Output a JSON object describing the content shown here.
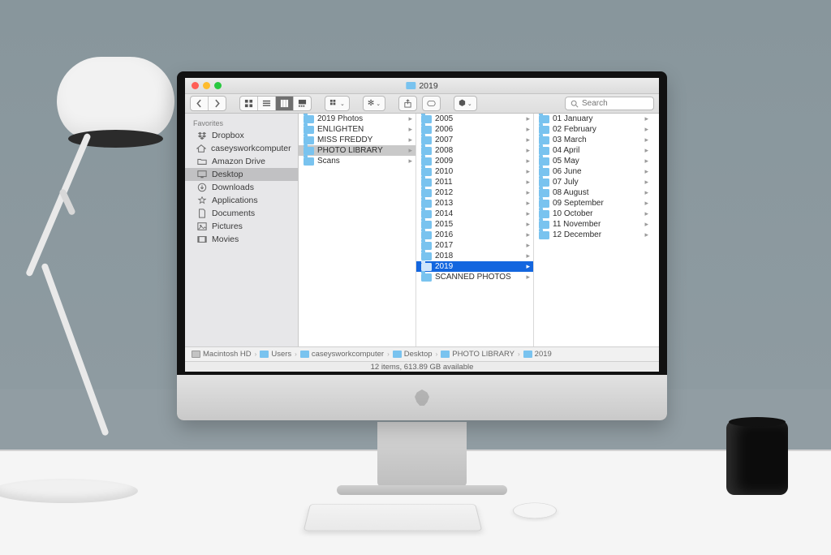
{
  "window": {
    "title": "2019"
  },
  "toolbar": {
    "search_placeholder": "Search"
  },
  "sidebar": {
    "header": "Favorites",
    "items": [
      {
        "label": "Dropbox",
        "icon": "dropbox"
      },
      {
        "label": "caseysworkcomputer",
        "icon": "home"
      },
      {
        "label": "Amazon Drive",
        "icon": "folder"
      },
      {
        "label": "Desktop",
        "icon": "desktop",
        "selected": true
      },
      {
        "label": "Downloads",
        "icon": "downloads"
      },
      {
        "label": "Applications",
        "icon": "applications"
      },
      {
        "label": "Documents",
        "icon": "documents"
      },
      {
        "label": "Pictures",
        "icon": "pictures"
      },
      {
        "label": "Movies",
        "icon": "movies"
      }
    ]
  },
  "columns": [
    {
      "items": [
        {
          "label": "2019 Photos"
        },
        {
          "label": "ENLIGHTEN"
        },
        {
          "label": "MISS FREDDY"
        },
        {
          "label": "PHOTO LIBRARY",
          "selected": "gray"
        },
        {
          "label": "Scans"
        }
      ]
    },
    {
      "items": [
        {
          "label": "2005"
        },
        {
          "label": "2006"
        },
        {
          "label": "2007"
        },
        {
          "label": "2008"
        },
        {
          "label": "2009"
        },
        {
          "label": "2010"
        },
        {
          "label": "2011"
        },
        {
          "label": "2012"
        },
        {
          "label": "2013"
        },
        {
          "label": "2014"
        },
        {
          "label": "2015"
        },
        {
          "label": "2016"
        },
        {
          "label": "2017"
        },
        {
          "label": "2018"
        },
        {
          "label": "2019",
          "selected": "blue"
        },
        {
          "label": "SCANNED PHOTOS"
        }
      ]
    },
    {
      "items": [
        {
          "label": "01 January"
        },
        {
          "label": "02 February"
        },
        {
          "label": "03 March"
        },
        {
          "label": "04 April"
        },
        {
          "label": "05 May"
        },
        {
          "label": "06 June"
        },
        {
          "label": "07 July"
        },
        {
          "label": "08 August"
        },
        {
          "label": "09 September"
        },
        {
          "label": "10 October"
        },
        {
          "label": "11 November"
        },
        {
          "label": "12 December"
        }
      ]
    }
  ],
  "pathbar": [
    {
      "label": "Macintosh HD",
      "icon": "hdd"
    },
    {
      "label": "Users",
      "icon": "folder"
    },
    {
      "label": "caseysworkcomputer",
      "icon": "folder"
    },
    {
      "label": "Desktop",
      "icon": "folder"
    },
    {
      "label": "PHOTO LIBRARY",
      "icon": "folder"
    },
    {
      "label": "2019",
      "icon": "folder"
    }
  ],
  "status": "12 items, 613.89 GB available"
}
